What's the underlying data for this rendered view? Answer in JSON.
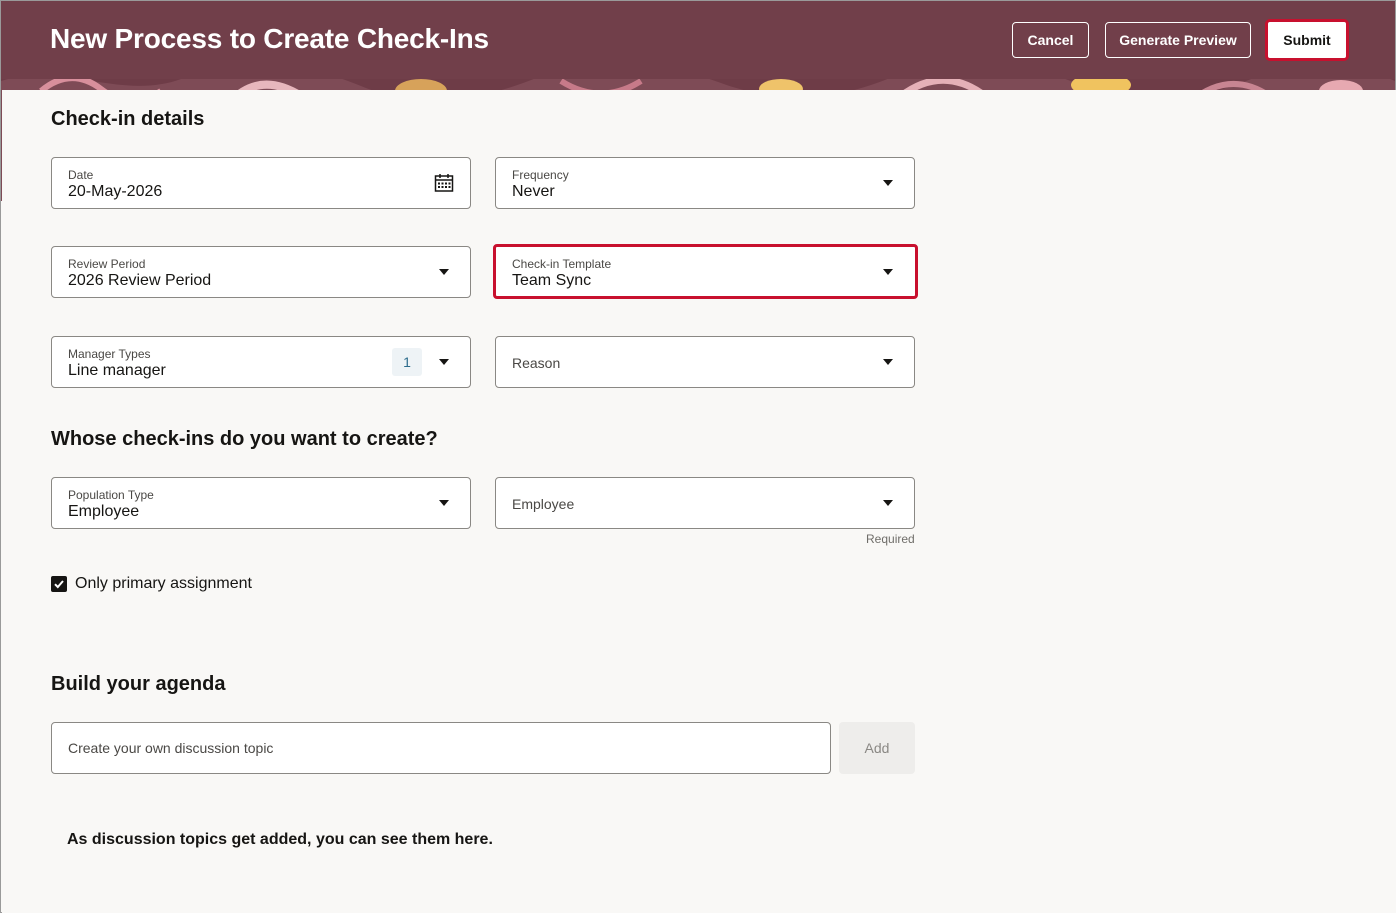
{
  "header": {
    "title": "New Process to Create Check-Ins",
    "cancel_label": "Cancel",
    "preview_label": "Generate Preview",
    "submit_label": "Submit"
  },
  "checkin_details": {
    "section_title": "Check-in details",
    "date": {
      "label": "Date",
      "value": "20-May-2026",
      "icon": "calendar-icon"
    },
    "frequency": {
      "label": "Frequency",
      "value": "Never"
    },
    "review_period": {
      "label": "Review Period",
      "value": "2026 Review Period"
    },
    "template": {
      "label": "Check-in Template",
      "value": "Team Sync"
    },
    "manager_types": {
      "label": "Manager Types",
      "value": "Line manager",
      "count": "1"
    },
    "reason": {
      "placeholder": "Reason"
    }
  },
  "whose": {
    "section_title": "Whose check-ins do you want to create?",
    "population_type": {
      "label": "Population Type",
      "value": "Employee"
    },
    "employee": {
      "placeholder": "Employee",
      "helper": "Required"
    },
    "primary_assignment": {
      "label": "Only primary assignment",
      "checked": true
    }
  },
  "agenda": {
    "section_title": "Build your agenda",
    "topic_placeholder": "Create your own discussion topic",
    "add_label": "Add",
    "empty_message": "As discussion topics get added, you can see them here."
  },
  "colors": {
    "banner": "#713f4a",
    "highlight": "#c8102e"
  }
}
